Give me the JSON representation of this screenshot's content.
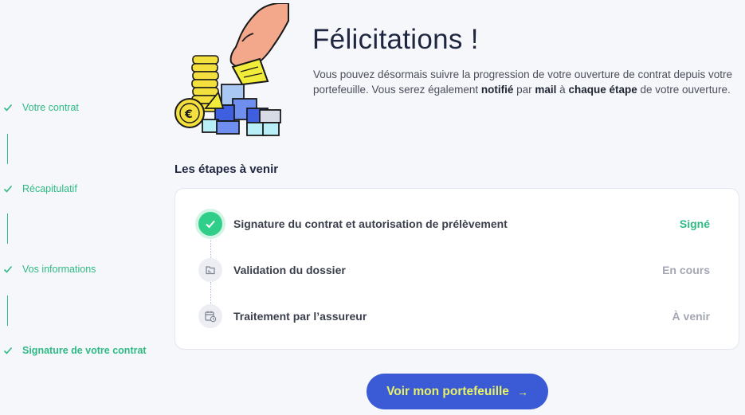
{
  "sidebar": {
    "steps": [
      {
        "label": "Votre contrat",
        "state": "done"
      },
      {
        "label": "Récapitulatif",
        "state": "done"
      },
      {
        "label": "Vos informations",
        "state": "done"
      },
      {
        "label": "Signature de votre contrat",
        "state": "active"
      }
    ]
  },
  "header": {
    "title": "Félicitations !",
    "intro_part1": "Vous pouvez désormais suivre la progression de votre ouverture de contrat depuis votre portefeuille. Vous serez également ",
    "intro_bold1": "notifié",
    "intro_part2": " par ",
    "intro_bold2": "mail",
    "intro_part3": " à ",
    "intro_bold3": "chaque étape",
    "intro_part4": " de votre ouverture."
  },
  "upcoming": {
    "title": "Les étapes à venir",
    "steps": [
      {
        "label": "Signature du contrat et autorisation de prélèvement",
        "status": "Signé",
        "icon": "check-icon"
      },
      {
        "label": "Validation du dossier",
        "status": "En cours",
        "icon": "folder-icon"
      },
      {
        "label": "Traitement par l’assureur",
        "status": "À venir",
        "icon": "calendar-clock-icon"
      }
    ]
  },
  "cta": {
    "label": "Voir mon portefeuille",
    "icon": "arrow-right-icon"
  },
  "colors": {
    "accent_green": "#2fba84",
    "primary_blue": "#3b5bd6",
    "cta_text": "#e8f266"
  }
}
